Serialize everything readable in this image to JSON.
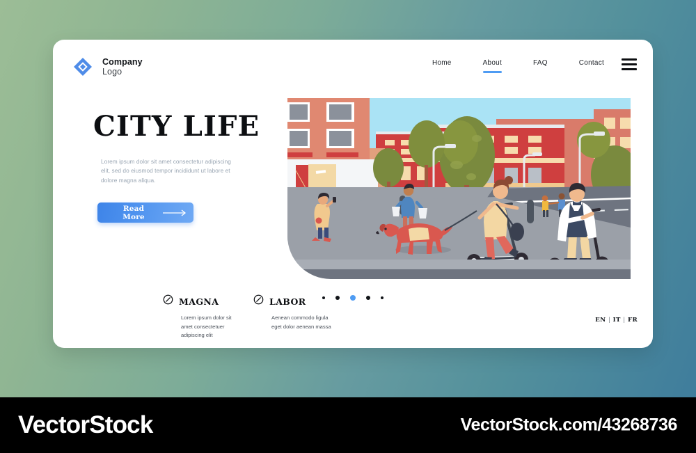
{
  "background": {
    "gradient_from": "#9cbd96",
    "gradient_to": "#3f7d9c"
  },
  "header": {
    "logo": {
      "icon": "diamond-logo-icon",
      "color": "#4f8ce8",
      "name": "Company",
      "subtitle": "Logo"
    },
    "nav": [
      {
        "label": "Home",
        "active": false
      },
      {
        "label": "About",
        "active": true
      },
      {
        "label": "FAQ",
        "active": false
      },
      {
        "label": "Contact",
        "active": false
      }
    ],
    "menu_icon": "hamburger-menu-icon",
    "active_underline_color": "#4f9cf3"
  },
  "hero": {
    "title": "CITY LIFE",
    "lead": "Lorem ipsum dolor sit amet consectetur adipiscing elit, sed do eiusmod tempor incididunt ut labore et dolore magna aliqua.",
    "cta": {
      "label": "Read More",
      "icon": "arrow-right-icon",
      "color_from": "#3e84e8",
      "color_to": "#6fa9f4"
    }
  },
  "features": [
    {
      "icon": "circle-slash-icon",
      "title": "MAGNA",
      "body": "Lorem ipsum dolor sit amet consectetuer adipiscing elit"
    },
    {
      "icon": "circle-slash-icon",
      "title": "LABOR",
      "body": "Aenean commodo ligula eget dolor aenean massa"
    }
  ],
  "illustration": {
    "name": "city-street-scooter-illustration",
    "description": "Flat vector city street scene with red and salmon apartment buildings, green trees, a woman riding an electric scooter while walking a dog, a man riding an electric scooter, pedestrians carrying shopping bags, street lamps and bollards",
    "sky_color": "#a9e2f5",
    "road_color": "#6e7480",
    "sidewalk_color": "#9ba0a8"
  },
  "carousel": {
    "dots": [
      {
        "active": false,
        "size": "s"
      },
      {
        "active": false,
        "size": "m"
      },
      {
        "active": true,
        "size": "m"
      },
      {
        "active": false,
        "size": "m"
      },
      {
        "active": false,
        "size": "s"
      }
    ],
    "active_index": 3,
    "active_color": "#4f9cf3"
  },
  "language": {
    "options": [
      "EN",
      "IT",
      "FR"
    ],
    "separator": "|"
  },
  "watermark": {
    "brand": "VectorStock",
    "url": "VectorStock.com/43268736"
  }
}
